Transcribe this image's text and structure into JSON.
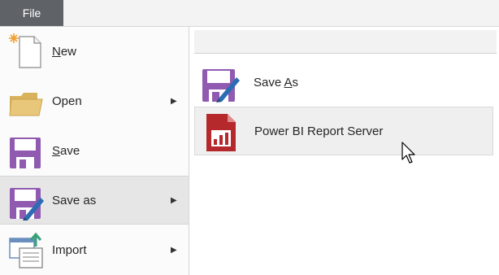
{
  "app": {
    "file_tab_label": "File"
  },
  "menu": {
    "items": [
      {
        "key": "new",
        "label": "New",
        "mnemonic": "N",
        "rest": "ew",
        "has_submenu": false
      },
      {
        "key": "open",
        "label": "Open",
        "has_submenu": true
      },
      {
        "key": "save",
        "label": "Save",
        "mnemonic": "S",
        "rest": "ave",
        "has_submenu": false
      },
      {
        "key": "save_as",
        "label": "Save as",
        "has_submenu": true,
        "selected": true
      },
      {
        "key": "import",
        "label": "Import",
        "has_submenu": true
      }
    ],
    "arrow_glyph": "▶"
  },
  "submenu": {
    "items": [
      {
        "key": "save_as",
        "label": "Save As",
        "prefix": "Save ",
        "mnemonic": "A",
        "rest": "s"
      },
      {
        "key": "power_bi_report_server",
        "label": "Power BI Report Server",
        "hovered": true
      }
    ]
  },
  "colors": {
    "file_tab": "#5f6368",
    "floppy_purple": "#8f5ab0",
    "pbi_red": "#b5282c",
    "pencil_blue": "#2b6cb3",
    "folder_tan": "#e9c77a"
  },
  "icons": {
    "new": "new-document-icon",
    "open": "folder-icon",
    "save": "floppy-disk-icon",
    "save_as": "floppy-disk-pencil-icon",
    "import": "import-icon",
    "pbi": "power-bi-report-icon",
    "cursor": "mouse-pointer-icon"
  }
}
